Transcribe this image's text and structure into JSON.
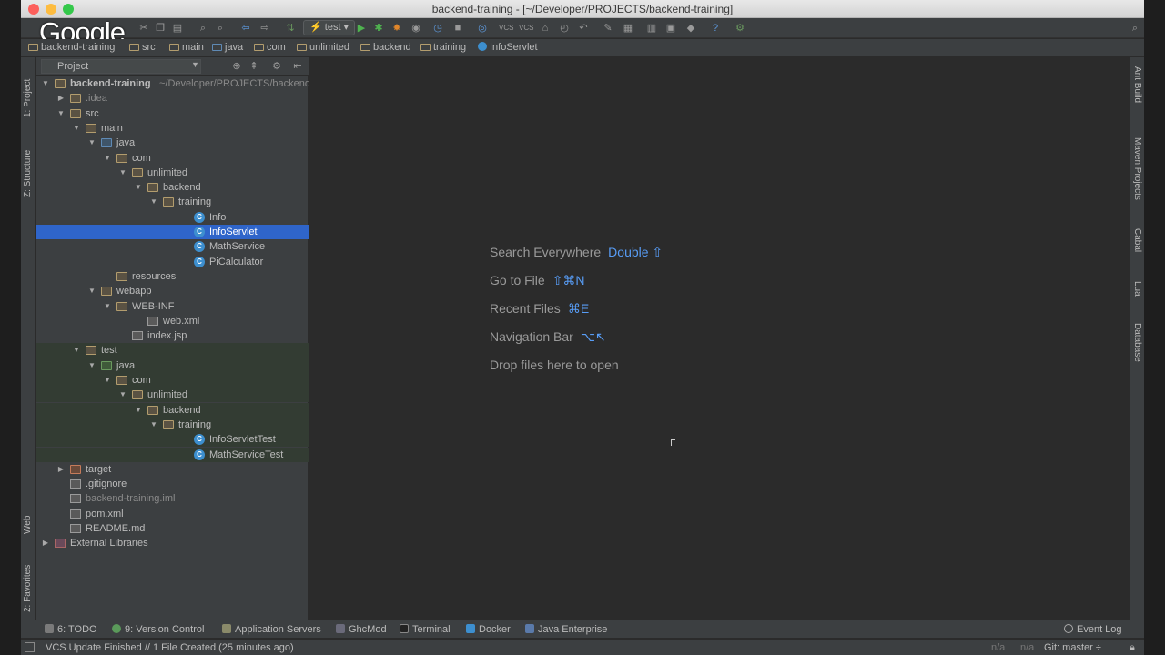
{
  "window": {
    "title": "backend-training - [~/Developer/PROJECTS/backend-training]"
  },
  "overlay": {
    "logo_text": "Google"
  },
  "toolbar": {
    "run_config": "test"
  },
  "breadcrumbs": [
    "backend-training",
    "src",
    "main",
    "java",
    "com",
    "unlimited",
    "backend",
    "training",
    "InfoServlet"
  ],
  "left_tool_windows": [
    "1: Project",
    "Z: Structure",
    "Web",
    "2: Favorites"
  ],
  "right_tool_windows": [
    "Ant Build",
    "Maven Projects",
    "Cabal",
    "Lua",
    "Database"
  ],
  "project_panel": {
    "title": "Project",
    "tree": [
      {
        "label": "backend-training",
        "suffix": "~/Developer/PROJECTS/backend",
        "indent": 0,
        "arrow": "down",
        "icon": "folder",
        "bold": true
      },
      {
        "label": ".idea",
        "indent": 1,
        "arrow": "right",
        "icon": "folder",
        "dim": true
      },
      {
        "label": "src",
        "indent": 1,
        "arrow": "down",
        "icon": "folder"
      },
      {
        "label": "main",
        "indent": 2,
        "arrow": "down",
        "icon": "folder"
      },
      {
        "label": "java",
        "indent": 3,
        "arrow": "down",
        "icon": "src"
      },
      {
        "label": "com",
        "indent": 4,
        "arrow": "down",
        "icon": "folder"
      },
      {
        "label": "unlimited",
        "indent": 5,
        "arrow": "down",
        "icon": "folder"
      },
      {
        "label": "backend",
        "indent": 6,
        "arrow": "down",
        "icon": "folder"
      },
      {
        "label": "training",
        "indent": 7,
        "arrow": "down",
        "icon": "folder"
      },
      {
        "label": "Info",
        "indent": 9,
        "arrow": "",
        "icon": "cls"
      },
      {
        "label": "InfoServlet",
        "indent": 9,
        "arrow": "",
        "icon": "cls",
        "selected": true
      },
      {
        "label": "MathService",
        "indent": 9,
        "arrow": "",
        "icon": "cls"
      },
      {
        "label": "PiCalculator",
        "indent": 9,
        "arrow": "",
        "icon": "cls"
      },
      {
        "label": "resources",
        "indent": 4,
        "arrow": "",
        "icon": "folder"
      },
      {
        "label": "webapp",
        "indent": 3,
        "arrow": "down",
        "icon": "folder"
      },
      {
        "label": "WEB-INF",
        "indent": 4,
        "arrow": "down",
        "icon": "folder"
      },
      {
        "label": "web.xml",
        "indent": 6,
        "arrow": "",
        "icon": "file"
      },
      {
        "label": "index.jsp",
        "indent": 5,
        "arrow": "",
        "icon": "file"
      },
      {
        "label": "test",
        "indent": 2,
        "arrow": "down",
        "icon": "folder",
        "test": true
      },
      {
        "label": "java",
        "indent": 3,
        "arrow": "down",
        "icon": "test",
        "test": true
      },
      {
        "label": "com",
        "indent": 4,
        "arrow": "down",
        "icon": "folder",
        "test": true
      },
      {
        "label": "unlimited",
        "indent": 5,
        "arrow": "down",
        "icon": "folder",
        "test": true
      },
      {
        "label": "backend",
        "indent": 6,
        "arrow": "down",
        "icon": "folder",
        "test": true
      },
      {
        "label": "training",
        "indent": 7,
        "arrow": "down",
        "icon": "folder",
        "test": true
      },
      {
        "label": "InfoServletTest",
        "indent": 9,
        "arrow": "",
        "icon": "cls",
        "test": true
      },
      {
        "label": "MathServiceTest",
        "indent": 9,
        "arrow": "",
        "icon": "cls",
        "test": true
      },
      {
        "label": "target",
        "indent": 1,
        "arrow": "right",
        "icon": "excluded"
      },
      {
        "label": ".gitignore",
        "indent": 1,
        "arrow": "",
        "icon": "file"
      },
      {
        "label": "backend-training.iml",
        "indent": 1,
        "arrow": "",
        "icon": "file",
        "dim": true
      },
      {
        "label": "pom.xml",
        "indent": 1,
        "arrow": "",
        "icon": "file"
      },
      {
        "label": "README.md",
        "indent": 1,
        "arrow": "",
        "icon": "file"
      },
      {
        "label": "External Libraries",
        "indent": 0,
        "arrow": "right",
        "icon": "lib"
      }
    ]
  },
  "editor": {
    "hints": [
      {
        "text": "Search Everywhere",
        "key": "Double ⇧"
      },
      {
        "text": "Go to File",
        "key": "⇧⌘N"
      },
      {
        "text": "Recent Files",
        "key": "⌘E"
      },
      {
        "text": "Navigation Bar",
        "key": "⌥↖"
      },
      {
        "text": "Drop files here to open",
        "key": ""
      }
    ]
  },
  "bottom_tabs": [
    "6: TODO",
    "9: Version Control",
    "Application Servers",
    "GhcMod",
    "Terminal",
    "Docker",
    "Java Enterprise"
  ],
  "event_log": "Event Log",
  "status": {
    "message": "VCS Update Finished // 1 File Created (25 minutes ago)",
    "pos1": "n/a",
    "pos2": "n/a",
    "git": "Git: master ÷"
  },
  "colors": {
    "selection": "#2f65ca",
    "hint_key": "#589df6",
    "background": "#2b2b2b"
  }
}
